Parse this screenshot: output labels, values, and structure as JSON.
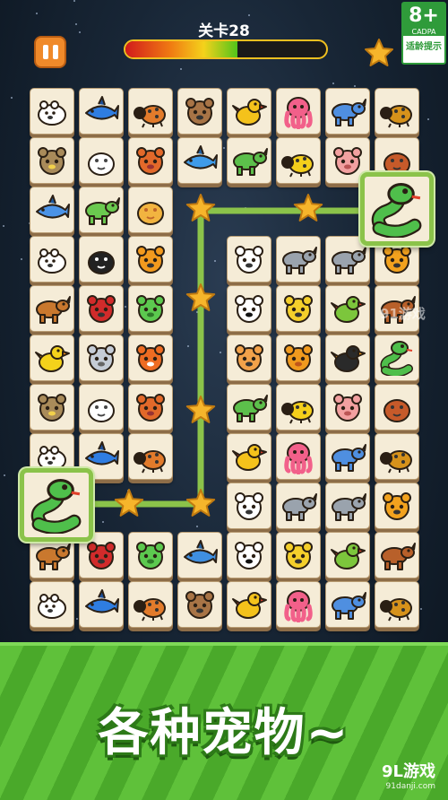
{
  "header": {
    "level_label": "关卡28",
    "progress": 0.56,
    "age_rating": {
      "num": "8+",
      "code": "CADPA",
      "hint": "适龄提示"
    }
  },
  "board": {
    "rows": [
      [
        "bear",
        "shark",
        "ladybug",
        "raccoon",
        "chicken",
        "octopus",
        "rhino",
        "ant"
      ],
      [
        "owl",
        "seal",
        "squirrel",
        "dolphin",
        "triceratops",
        "bee",
        "pig",
        "hedgehog"
      ],
      [
        "fish",
        "dinosaur",
        "snail",
        null,
        null,
        null,
        null,
        "snake"
      ],
      [
        "bear",
        "penguin",
        "tiger",
        null,
        "monkey",
        "hippo",
        "elephant",
        "dog"
      ],
      [
        "horse",
        "gorilla",
        "frog",
        null,
        "panda",
        "leopard",
        "parrot",
        "bull"
      ],
      [
        "duck",
        "mouse",
        "fox",
        null,
        "cat",
        "lion",
        "toucan",
        "snake"
      ],
      [
        "owl",
        "seal",
        "squirrel",
        null,
        "triceratops",
        "bee",
        "pig",
        "hedgehog"
      ],
      [
        "bear",
        "shark",
        "ladybug",
        null,
        "chicken",
        "octopus",
        "rhino",
        "ant"
      ],
      [
        "snake",
        null,
        null,
        null,
        "monkey",
        "hippo",
        "elephant",
        "dog"
      ],
      [
        "horse",
        "gorilla",
        "frog",
        "whale",
        "panda",
        "leopard",
        "parrot",
        "bull"
      ],
      [
        "bear",
        "shark",
        "ladybug",
        "raccoon",
        "chicken",
        "octopus",
        "rhino",
        "ant"
      ]
    ],
    "selected": [
      "snake",
      "snake"
    ]
  },
  "footer": {
    "slogan": "各种宠物~",
    "watermark_inline": "91游戏",
    "watermark_main": "9L游戏",
    "watermark_url": "91danji.com"
  },
  "colors": {
    "accent": "#8bc34a",
    "pause": "#f08a2a",
    "banner": "#5fc13a",
    "tile": "#f5ecd7"
  }
}
